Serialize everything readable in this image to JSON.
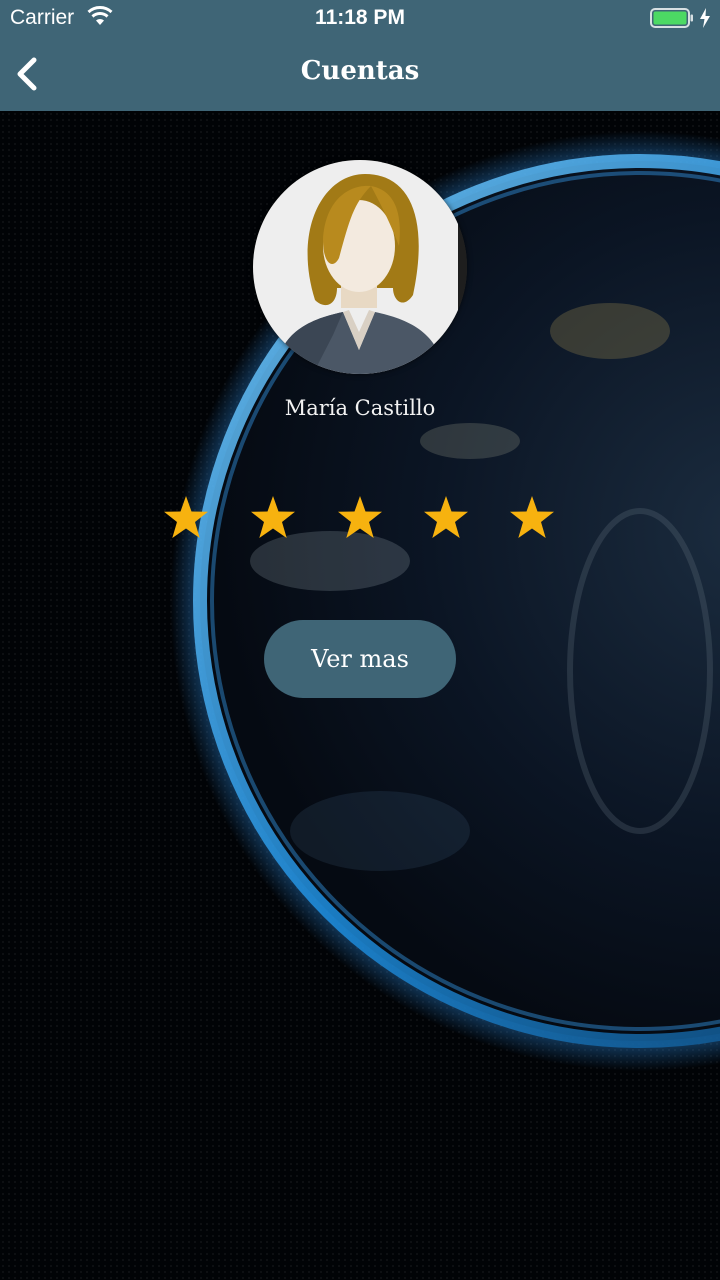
{
  "status_bar": {
    "carrier": "Carrier",
    "time": "11:18 PM",
    "battery_color": "#4cd964"
  },
  "nav": {
    "title": "Cuentas",
    "back_icon": "chevron-left-icon"
  },
  "profile": {
    "name": "María Castillo",
    "avatar_icon": "female-avatar-icon"
  },
  "rating": {
    "value": 5,
    "max": 5,
    "star_color": "#f7b20f"
  },
  "actions": {
    "ver_mas": "Ver mas"
  },
  "colors": {
    "accent": "#3f6576",
    "background": "#000000"
  }
}
